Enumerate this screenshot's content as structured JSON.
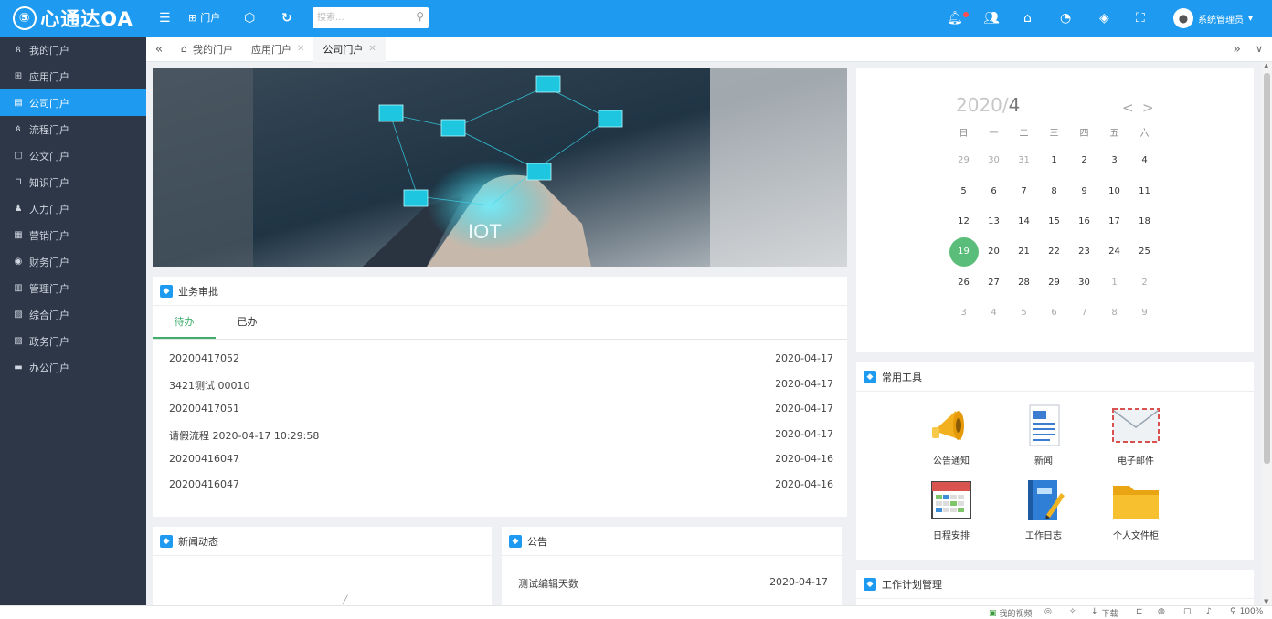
{
  "app": {
    "logo_text": "心通达OA",
    "logo_mark": "⑤"
  },
  "topbar": {
    "portal_label": "门户",
    "search_placeholder": "搜索...",
    "user_name": "系统管理员"
  },
  "sidebar": {
    "items": [
      {
        "label": "我的门户",
        "icon": "ጰ"
      },
      {
        "label": "应用门户",
        "icon": "⊞"
      },
      {
        "label": "公司门户",
        "icon": "▤"
      },
      {
        "label": "流程门户",
        "icon": "ጰ"
      },
      {
        "label": "公文门户",
        "icon": "▢"
      },
      {
        "label": "知识门户",
        "icon": "⊓"
      },
      {
        "label": "人力门户",
        "icon": "♟"
      },
      {
        "label": "营销门户",
        "icon": "▦"
      },
      {
        "label": "财务门户",
        "icon": "◉"
      },
      {
        "label": "管理门户",
        "icon": "▥"
      },
      {
        "label": "综合门户",
        "icon": "▧"
      },
      {
        "label": "政务门户",
        "icon": "▧"
      },
      {
        "label": "办公门户",
        "icon": "▬"
      }
    ],
    "active_index": 2
  },
  "tabs": {
    "items": [
      {
        "label": "我的门户",
        "home": true
      },
      {
        "label": "应用门户",
        "closable": true
      },
      {
        "label": "公司门户",
        "closable": true,
        "active": true
      }
    ]
  },
  "banner": {
    "text": "IOT"
  },
  "approval": {
    "title": "业务审批",
    "tabs": [
      "待办",
      "已办"
    ],
    "rows": [
      {
        "name": "20200417052",
        "date": "2020-04-17"
      },
      {
        "name": "3421测试 00010",
        "date": "2020-04-17"
      },
      {
        "name": "20200417051",
        "date": "2020-04-17"
      },
      {
        "name": "请假流程 2020-04-17 10:29:58",
        "date": "2020-04-17"
      },
      {
        "name": "20200416047",
        "date": "2020-04-16"
      },
      {
        "name": "20200416047",
        "date": "2020-04-16"
      }
    ]
  },
  "news": {
    "title": "新闻动态"
  },
  "notice": {
    "title": "公告",
    "rows": [
      {
        "name": "测试编辑天数",
        "date": "2020-04-17"
      }
    ]
  },
  "calendar": {
    "year": "2020/",
    "month": "4",
    "weekdays": [
      "日",
      "一",
      "二",
      "三",
      "四",
      "五",
      "六"
    ],
    "weeks": [
      [
        "29",
        "30",
        "31",
        "1",
        "2",
        "3",
        "4"
      ],
      [
        "5",
        "6",
        "7",
        "8",
        "9",
        "10",
        "11"
      ],
      [
        "12",
        "13",
        "14",
        "15",
        "16",
        "17",
        "18"
      ],
      [
        "19",
        "20",
        "21",
        "22",
        "23",
        "24",
        "25"
      ],
      [
        "26",
        "27",
        "28",
        "29",
        "30",
        "1",
        "2"
      ],
      [
        "3",
        "4",
        "5",
        "6",
        "7",
        "8",
        "9"
      ]
    ],
    "today": "19"
  },
  "tools": {
    "title": "常用工具",
    "items": [
      {
        "label": "公告通知",
        "icon": "megaphone-icon"
      },
      {
        "label": "新闻",
        "icon": "document-icon"
      },
      {
        "label": "电子邮件",
        "icon": "envelope-icon"
      },
      {
        "label": "日程安排",
        "icon": "calendar-icon"
      },
      {
        "label": "工作日志",
        "icon": "notebook-icon"
      },
      {
        "label": "个人文件柜",
        "icon": "folder-icon"
      }
    ]
  },
  "workplan": {
    "title": "工作计划管理"
  },
  "statusbar": {
    "video": "我的视频",
    "download": "下载",
    "zoom": "100%"
  },
  "colors": {
    "primary": "#1e9bf0",
    "sidebar": "#2d3747",
    "today": "#5bbd7a",
    "badge": "#ff4d4f"
  }
}
